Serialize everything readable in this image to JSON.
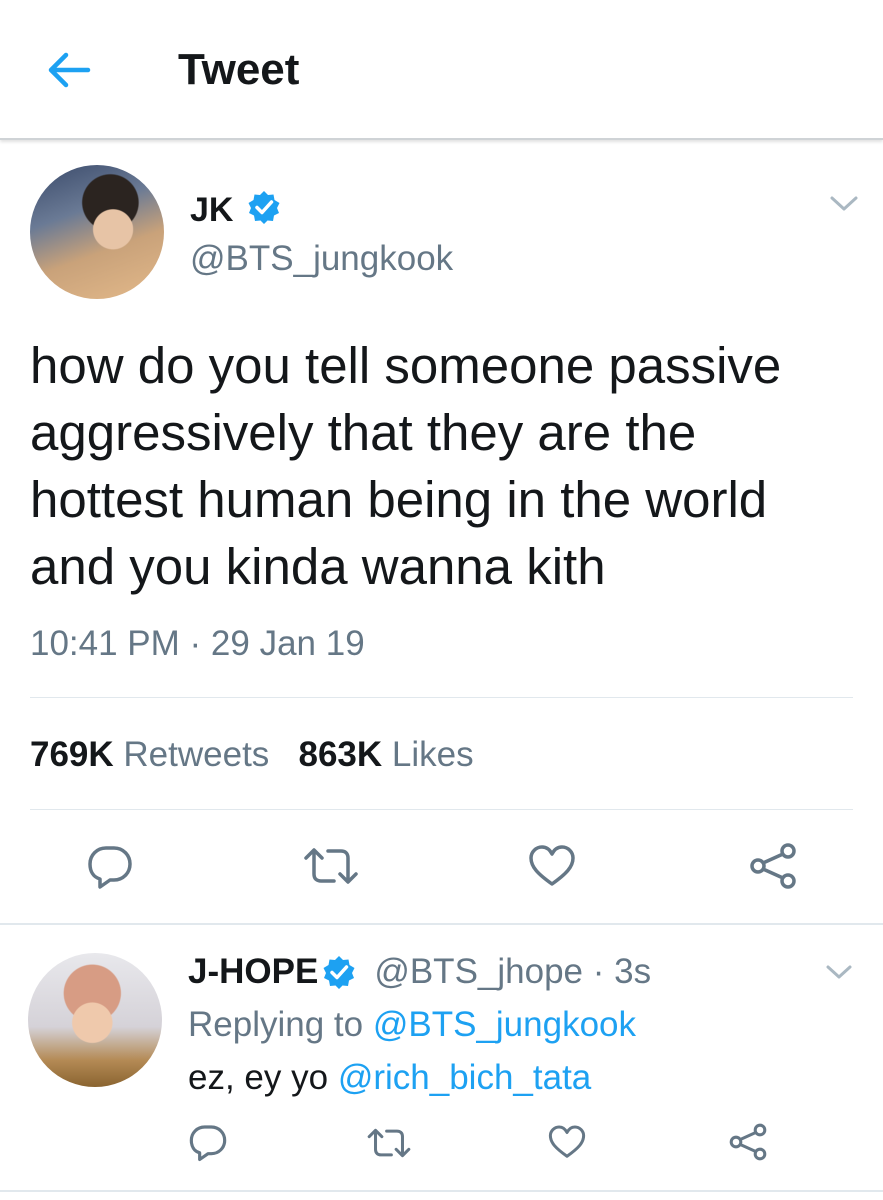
{
  "header": {
    "title": "Tweet"
  },
  "tweet": {
    "author_name": "JK",
    "author_handle": "@BTS_jungkook",
    "text_lines": [
      "how do you tell someone passive",
      "aggressively that they are the",
      "hottest human being in the world",
      "and you kinda wanna kith"
    ],
    "time": "10:41 PM",
    "separator": " · ",
    "date": "29 Jan 19",
    "retweets_count": "769K",
    "retweets_label": "Retweets",
    "likes_count": "863K",
    "likes_label": "Likes"
  },
  "reply": {
    "author_name": "J-HOPE",
    "author_handle": "@BTS_jhope",
    "age": "3s",
    "replying_prefix": "Replying to",
    "replying_to": "@BTS_jungkook",
    "text_prefix": "ez, ey yo",
    "mention": "@rich_bich_tata"
  },
  "colors": {
    "accent": "#1da1f2",
    "secondary_text": "#657786",
    "icon": "#657786",
    "divider": "#e1e8ed"
  },
  "icons": {
    "back": "arrow-left-icon",
    "verified": "verified-badge-icon",
    "more": "chevron-down-icon",
    "reply": "reply-bubble-icon",
    "retweet": "retweet-icon",
    "like": "heart-icon",
    "share": "share-icon"
  }
}
